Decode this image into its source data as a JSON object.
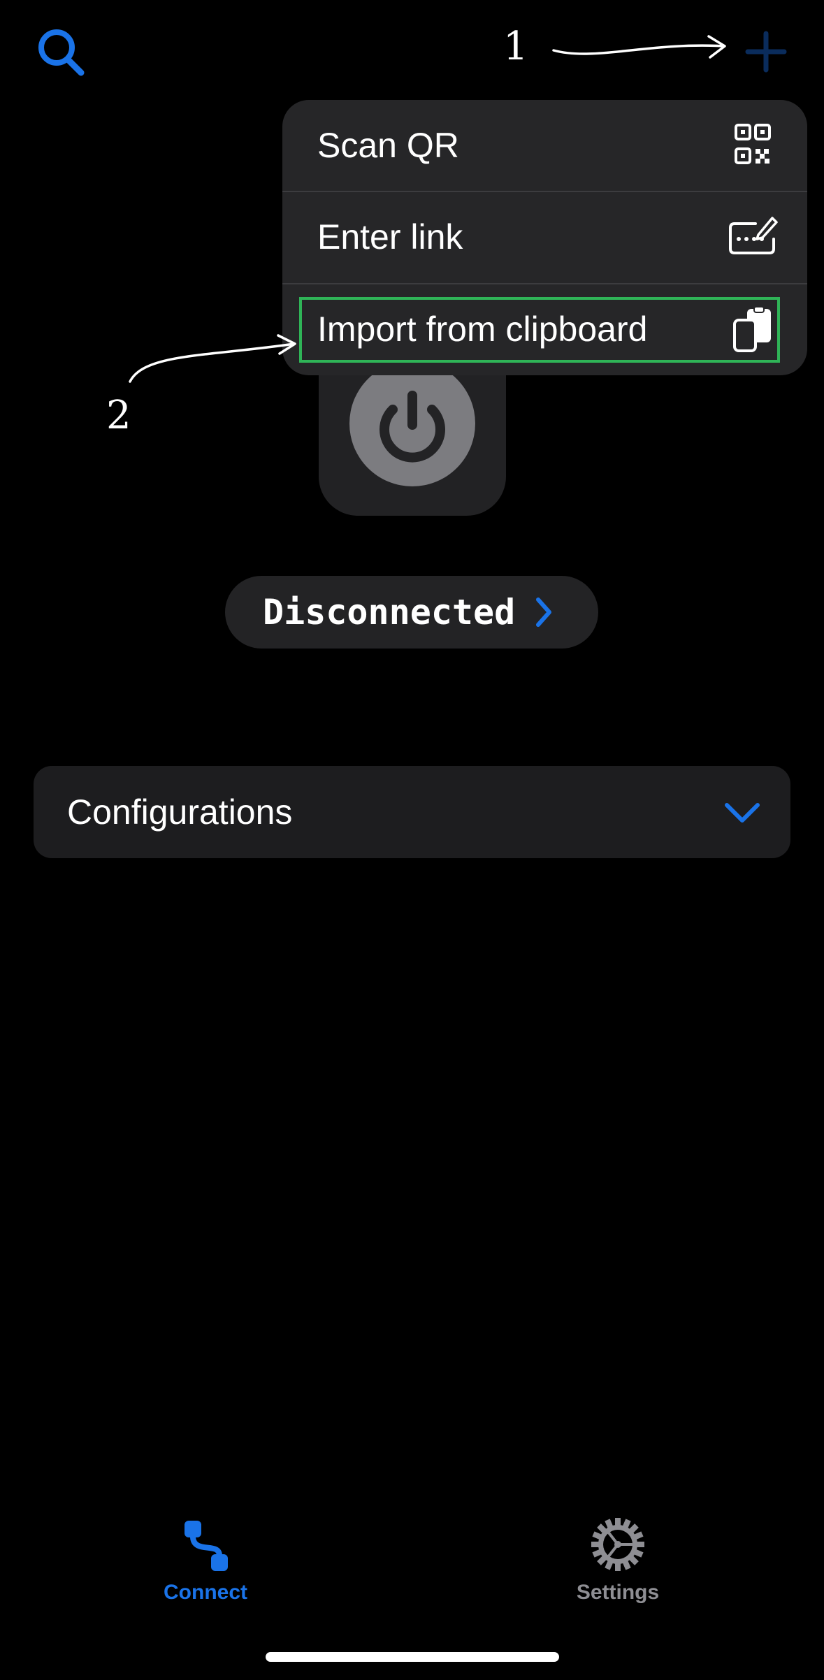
{
  "annotations": {
    "step1": "1",
    "step2": "2"
  },
  "menu": {
    "items": [
      {
        "label": "Scan QR",
        "icon": "qr-code-icon"
      },
      {
        "label": "Enter link",
        "icon": "keyboard-pen-icon"
      },
      {
        "label": "Import from clipboard",
        "icon": "clipboard-icon"
      }
    ]
  },
  "status": {
    "label": "Disconnected",
    "chevron": "chevron-right-icon"
  },
  "configurations": {
    "label": "Configurations",
    "chevron": "chevron-down-icon"
  },
  "tabbar": {
    "tabs": [
      {
        "label": "Connect",
        "icon": "connect-route-icon",
        "active": true
      },
      {
        "label": "Settings",
        "icon": "gear-icon",
        "active": false
      }
    ]
  },
  "colors": {
    "accent": "#1a73e8",
    "highlight": "#2fb457",
    "inactive_tab": "#8e8e93",
    "add_button": "#0a2c5c"
  }
}
